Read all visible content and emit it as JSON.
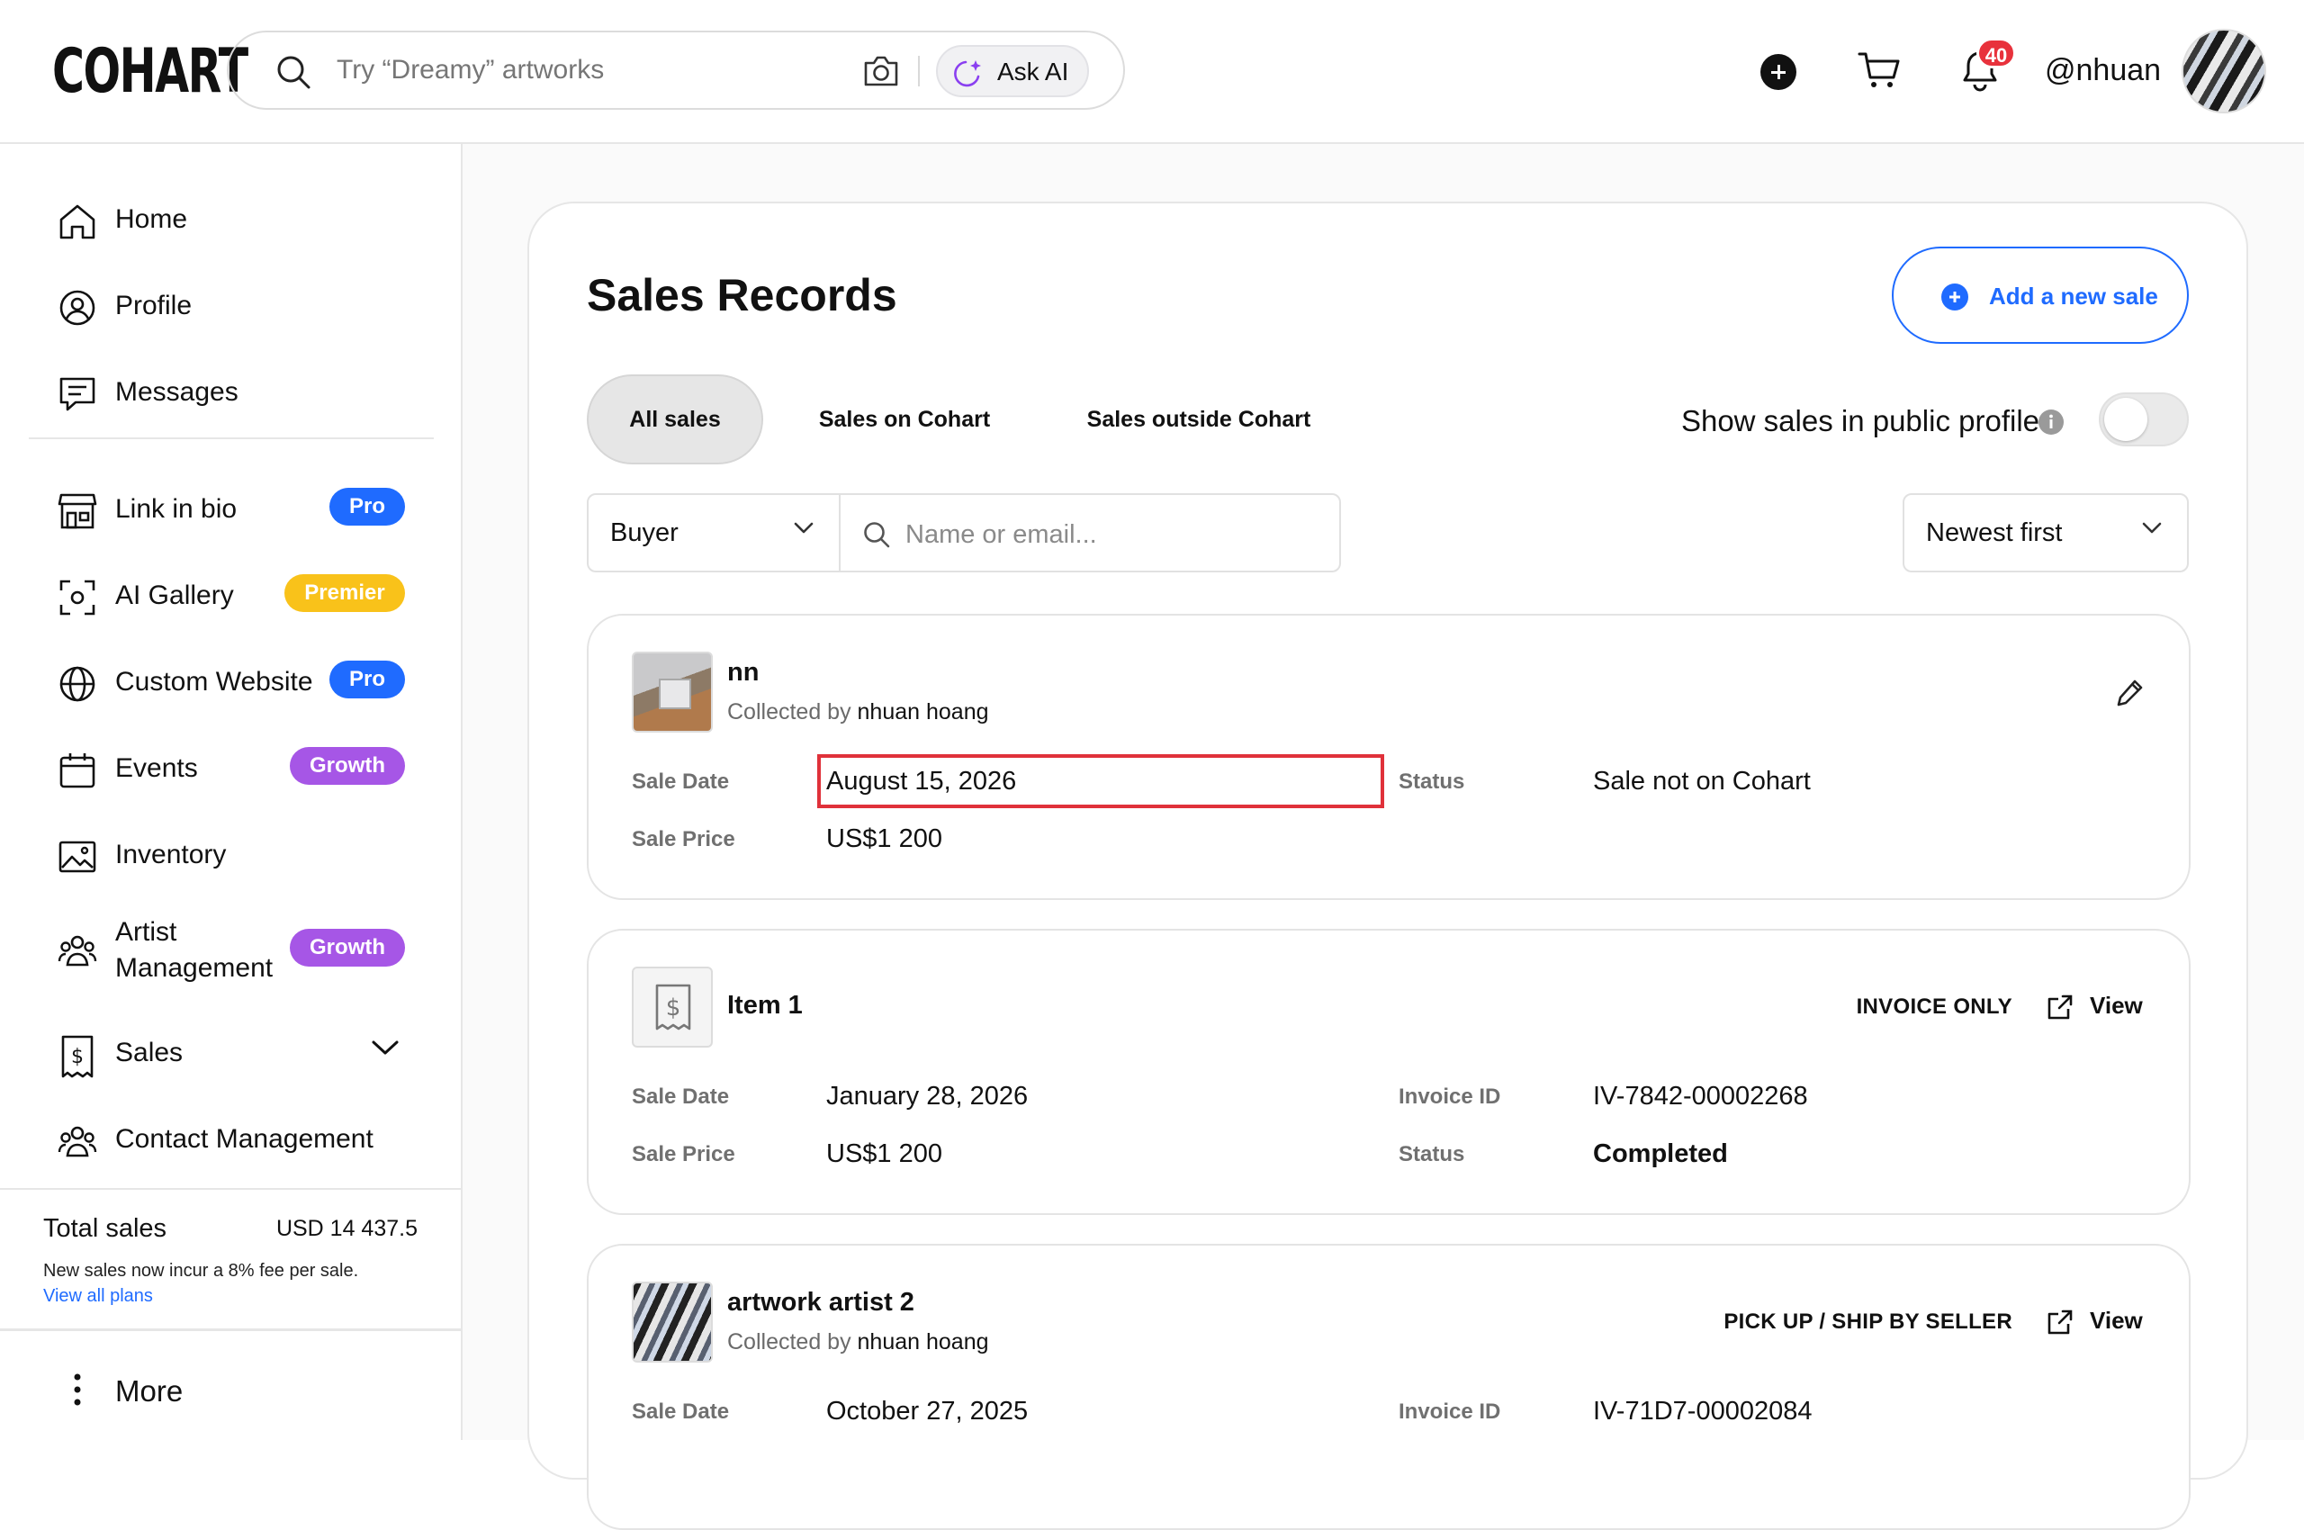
{
  "header": {
    "logo": "COHART",
    "search_placeholder": "Try “Dreamy” artworks",
    "ask_ai_label": "Ask AI",
    "notification_count": "40",
    "username": "@nhuan",
    "icons": [
      "search-icon",
      "camera-icon",
      "sparkle-icon",
      "plus-circle-icon",
      "cart-icon",
      "bell-icon",
      "avatar"
    ]
  },
  "sidebar": {
    "items": [
      {
        "label": "Home",
        "icon": "home-icon"
      },
      {
        "label": "Profile",
        "icon": "profile-icon"
      },
      {
        "label": "Messages",
        "icon": "messages-icon"
      },
      {
        "label": "Link in bio",
        "icon": "storefront-icon",
        "badge": "Pro"
      },
      {
        "label": "AI Gallery",
        "icon": "scan-icon",
        "badge": "Premier"
      },
      {
        "label": "Custom Website",
        "icon": "globe-icon",
        "badge": "Pro"
      },
      {
        "label": "Events",
        "icon": "calendar-icon",
        "badge": "Growth"
      },
      {
        "label": "Inventory",
        "icon": "image-icon"
      },
      {
        "label": "Artist Management",
        "label_line1": "Artist",
        "label_line2": "Management",
        "icon": "users-icon",
        "badge": "Growth"
      },
      {
        "label": "Sales",
        "icon": "dollar-receipt-icon"
      },
      {
        "label": "Contact Management",
        "icon": "contacts-icon"
      }
    ],
    "total_sales_label": "Total sales",
    "total_sales_value": "USD 14 437.5",
    "fee_note": "New sales now incur a 8% fee per sale.",
    "plans_link": "View all plans",
    "more_label": "More"
  },
  "main": {
    "title": "Sales Records",
    "add_button": "Add a new sale",
    "tabs": [
      "All sales",
      "Sales on Cohart",
      "Sales outside Cohart"
    ],
    "active_tab": "All sales",
    "public_toggle_label": "Show sales in public profile",
    "public_toggle_on": false,
    "filter_field": "Buyer",
    "filter_placeholder": "Name or email...",
    "sort": "Newest first"
  },
  "labels": {
    "sale_date": "Sale Date",
    "sale_price": "Sale Price",
    "status": "Status",
    "invoice_id": "Invoice ID",
    "collected_by": "Collected by",
    "view": "View"
  },
  "sales": [
    {
      "title": "nn",
      "collected_by": "nhuan hoang",
      "sale_date": "August 15, 2026",
      "sale_price": "US$1 200",
      "status": "Sale not on Cohart"
    },
    {
      "title": "Item 1",
      "tag": "INVOICE ONLY",
      "sale_date": "January 28, 2026",
      "sale_price": "US$1 200",
      "invoice_id": "IV-7842-00002268",
      "status": "Completed"
    },
    {
      "title": "artwork artist 2",
      "collected_by": "nhuan hoang",
      "tag": "PICK UP / SHIP BY SELLER",
      "sale_date": "October 27, 2025",
      "invoice_id": "IV-71D7-00002084"
    }
  ],
  "colors": {
    "accent": "#1f6bff",
    "badge_pro": "#1f6bff",
    "badge_premier": "#f9c21a",
    "badge_growth": "#a656e6",
    "notification": "#e8323c",
    "highlight": "#e0313a"
  }
}
